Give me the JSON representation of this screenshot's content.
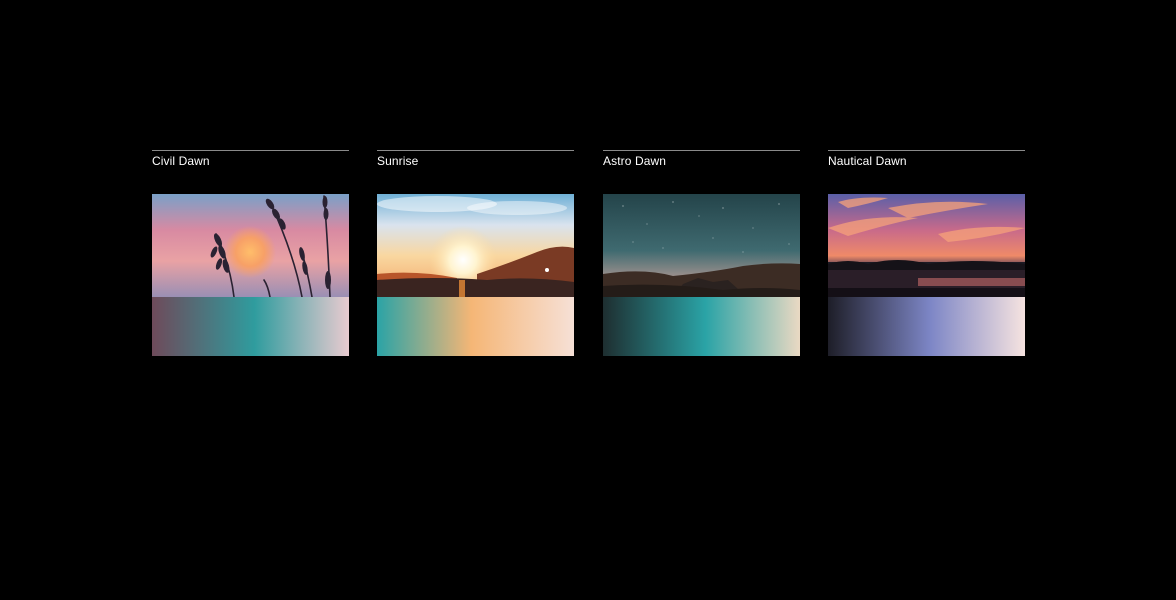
{
  "cards": [
    {
      "title": "Civil Dawn",
      "gradient": [
        "#6e4a5a",
        "#2f9c9e",
        "#e9cbd0"
      ]
    },
    {
      "title": "Sunrise",
      "gradient": [
        "#2aa3a6",
        "#f5b676",
        "#f6e0d6"
      ]
    },
    {
      "title": "Astro Dawn",
      "gradient": [
        "#1e2e30",
        "#2aa3a6",
        "#ead9c3"
      ]
    },
    {
      "title": "Nautical Dawn",
      "gradient": [
        "#1e1e28",
        "#7d86c6",
        "#f6e3e0"
      ]
    }
  ]
}
